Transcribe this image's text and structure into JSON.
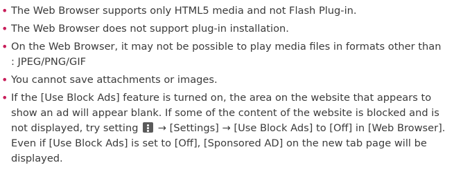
{
  "notes": [
    {
      "text": "The Web Browser supports only HTML5 media and not Flash Plug-in."
    },
    {
      "text": "The Web Browser does not support plug-in installation."
    },
    {
      "text": "On the Web Browser, it may not be possible to play media files in formats other than",
      "formats": ": JPEG/PNG/GIF"
    },
    {
      "text": "You cannot save attachments or images."
    },
    {
      "text_before_icon": "If the [Use Block Ads] feature is turned on, the area on the website that appears to show an ad will appear blank. If some of the content of the website is blocked and is not displayed, try setting",
      "icon": "more-menu-icon",
      "text_after_icon": "→ [Settings] → [Use Block Ads] to [Off] in [Web Browser]. Even if [Use Block Ads] is set to [Off], [Sponsored AD] on the new tab page will be displayed."
    }
  ],
  "colors": {
    "bullet": "#c81e5a",
    "text": "#3a3a3a",
    "icon_bg": "#5a5a5a"
  }
}
